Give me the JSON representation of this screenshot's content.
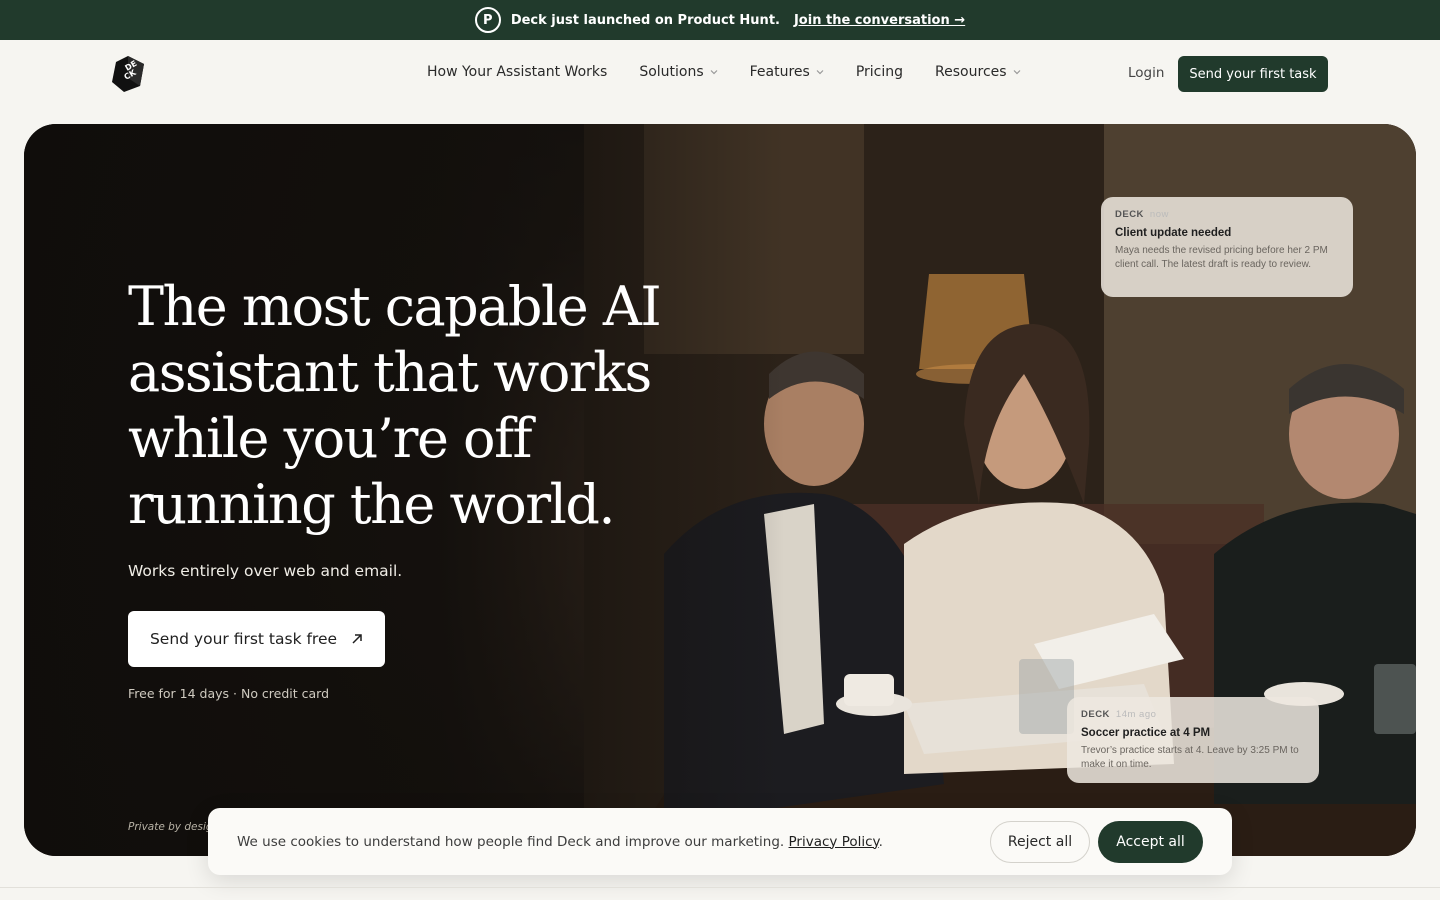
{
  "announcement": {
    "badge": "P",
    "text": "Deck just launched on Product Hunt.",
    "link": "Join the conversation →"
  },
  "nav": {
    "logo_text": "DECK",
    "links": [
      {
        "label": "How Your Assistant Works",
        "dropdown": false
      },
      {
        "label": "Solutions",
        "dropdown": true
      },
      {
        "label": "Features",
        "dropdown": true
      },
      {
        "label": "Pricing",
        "dropdown": false
      },
      {
        "label": "Resources",
        "dropdown": true
      }
    ],
    "login": "Login",
    "cta": "Send your first task"
  },
  "hero": {
    "headline": "The most capable AI assistant that works while you’re off running the world.",
    "subheading": "Works entirely over web and email.",
    "cta": "Send your first task free",
    "fine_print": "Free for 14 days · No credit card",
    "private_note": "Private by design",
    "notifications": [
      {
        "brand": "DECK",
        "time": "now",
        "title": "Client update needed",
        "body": "Maya needs the revised pricing before her 2 PM client call. The latest draft is ready to review."
      },
      {
        "brand": "DECK",
        "time": "14m ago",
        "title": "Soccer practice at 4 PM",
        "body": "Trevor’s practice starts at 4. Leave by 3:25 PM to make it on time."
      }
    ]
  },
  "cookie": {
    "text": "We use cookies to understand how people find Deck and improve our marketing.",
    "link": "Privacy Policy",
    "reject": "Reject all",
    "accept": "Accept all"
  },
  "colors": {
    "brand_green": "#213a2c",
    "page_bg": "#f6f5f1"
  }
}
